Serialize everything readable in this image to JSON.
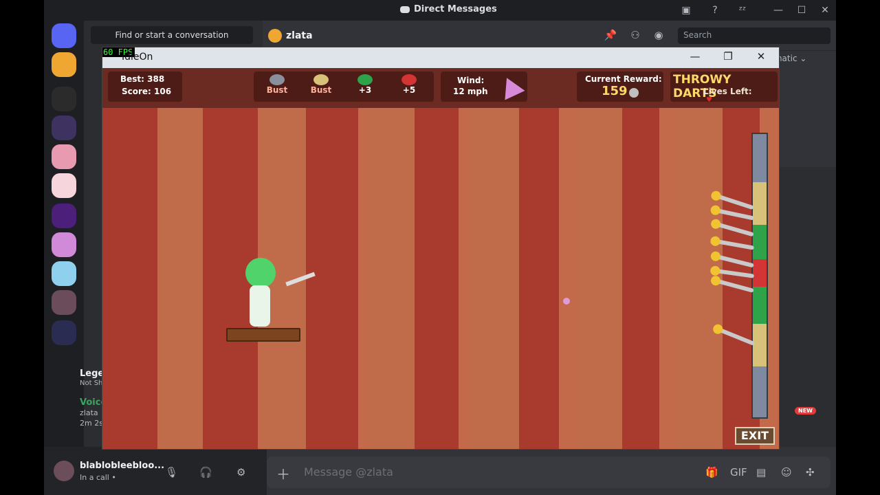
{
  "window": {
    "title": "Direct Messages"
  },
  "dm": {
    "find_placeholder": "Find or start a conversation"
  },
  "header": {
    "user": "zlata",
    "search_placeholder": "Search",
    "automatic": "Automatic"
  },
  "voice": {
    "server": "Lege",
    "sub": "Not Sh",
    "label": "Voice",
    "user": "zlata",
    "time": "2m 2s"
  },
  "user": {
    "name": "blablobleebloo...",
    "status": "In a call •"
  },
  "message": {
    "placeholder": "Message @zlata"
  },
  "game": {
    "window_title": "IdleOn",
    "fps": "60 FPS",
    "best": "Best: 388",
    "score": "Score: 106",
    "darts": [
      {
        "label": "Bust",
        "color": "#8a8f9c"
      },
      {
        "label": "Bust",
        "color": "#d8c27a"
      },
      {
        "label": "+3",
        "color": "#2ea34a"
      },
      {
        "label": "+5",
        "color": "#d33434"
      }
    ],
    "wind_label": "Wind:",
    "wind_value": "12 mph",
    "reward_label": "Current Reward:",
    "reward_value": "159",
    "game_name": "THROWY DARTS",
    "lives_label": "Lives Left:",
    "exit": "EXIT",
    "new_badge": "NEW"
  }
}
